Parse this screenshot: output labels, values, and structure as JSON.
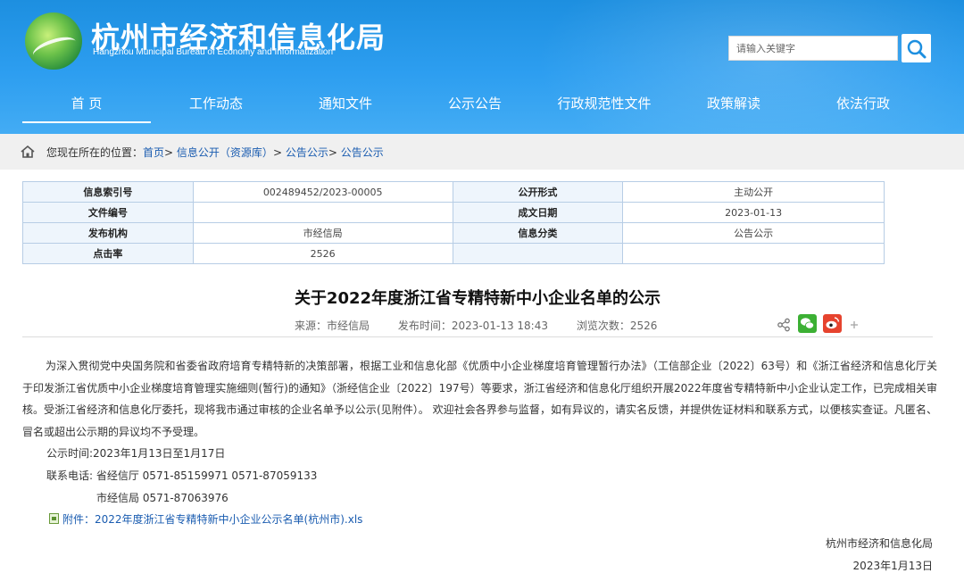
{
  "header": {
    "title": "杭州市经济和信息化局",
    "subtitle": "Hangzhou Municipal Bureau of Economy and Informatization",
    "search_placeholder": "请输入关键字"
  },
  "nav": [
    "首 页",
    "工作动态",
    "通知文件",
    "公示公告",
    "行政规范性文件",
    "政策解读",
    "依法行政"
  ],
  "breadcrumb": {
    "prefix": "您现在所在的位置：",
    "items": [
      "首页",
      "信息公开（资源库）",
      "公告公示",
      "公告公示"
    ],
    "separator": ">"
  },
  "info_table": [
    [
      "信息索引号",
      "002489452/2023-00005",
      "公开形式",
      "主动公开"
    ],
    [
      "文件编号",
      "",
      "成文日期",
      "2023-01-13"
    ],
    [
      "发布机构",
      "市经信局",
      "信息分类",
      "公告公示"
    ],
    [
      "点击率",
      "2526",
      "",
      ""
    ]
  ],
  "article": {
    "title": "关于2022年度浙江省专精特新中小企业名单的公示",
    "source": "来源：市经信局",
    "published": "发布时间：2023-01-13 18:43",
    "views": "浏览次数：2526",
    "paragraph": "为深入贯彻党中央国务院和省委省政府培育专精特新的决策部署，根据工业和信息化部《优质中小企业梯度培育管理暂行办法》（工信部企业〔2022〕63号）和《浙江省经济和信息化厅关于印发浙江省优质中小企业梯度培育管理实施细则(暂行)的通知》（浙经信企业〔2022〕197号）等要求，浙江省经济和信息化厅组织开展2022年度省专精特新中小企业认定工作，已完成相关审核。受浙江省经济和信息化厅委托，现将我市通过审核的企业名单予以公示(见附件）。  欢迎社会各界参与监督，如有异议的，请实名反馈，并提供佐证材料和联系方式，以便核实查证。凡匿名、冒名或超出公示期的异议均不予受理。",
    "period": "公示时间:2023年1月13日至1月17日",
    "contact1": "联系电话: 省经信厅 0571-85159971 0571-87059133",
    "contact2": "市经信局 0571-87063976",
    "attachment": "附件：2022年度浙江省专精特新中小企业公示名单(杭州市).xls",
    "signature_org": "杭州市经济和信息化局",
    "signature_date": "2023年1月13日"
  },
  "colors": {
    "header_blue": "#2d9ef0",
    "link_blue": "#1a5cb0",
    "wechat": "#3cb034",
    "weibo": "#e6432e"
  }
}
